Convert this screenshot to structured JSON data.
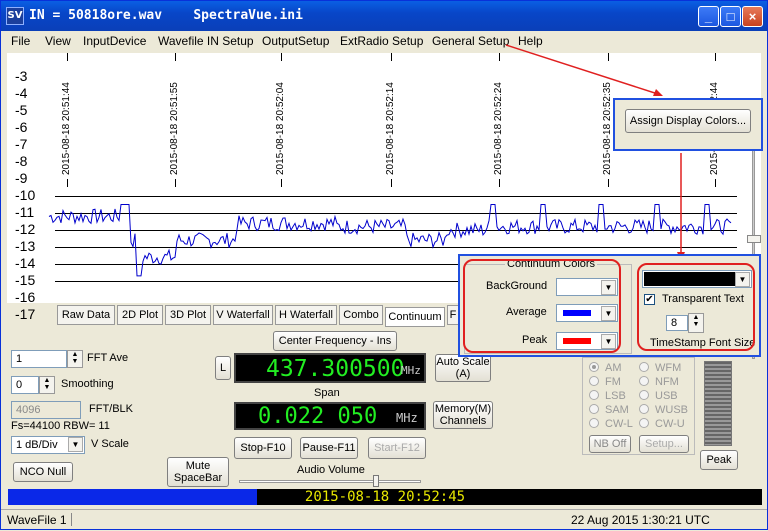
{
  "window": {
    "title": "IN = 50818ore.wav    SpectraVue.ini",
    "icon_label": "SV",
    "minimize": "_",
    "maximize": "□",
    "close": "×"
  },
  "menu": [
    "File",
    "View",
    "InputDevice",
    "Wavefile IN Setup",
    "OutputSetup",
    "ExtRadio Setup",
    "General Setup",
    "Help"
  ],
  "plot": {
    "y_ticks": [
      "-3",
      "-4",
      "-5",
      "-6",
      "-7",
      "-8",
      "-9",
      "-10",
      "-11",
      "-12",
      "-13",
      "-14",
      "-15",
      "-16",
      "-17"
    ],
    "time_labels": [
      "2015-08-18 20:51:44",
      "2015-08-18 20:51:55",
      "2015-08-18 20:52:04",
      "2015-08-18 20:52:14",
      "2015-08-18 20:52:24",
      "2015-08-18 20:52:35",
      "2015-08-18 20:52:44"
    ],
    "line_color": "#0000CC"
  },
  "tabs": [
    "Raw Data",
    "2D Plot",
    "3D Plot",
    "V Waterfall",
    "H Waterfall",
    "Combo",
    "Continuum",
    "F"
  ],
  "controls": {
    "fft_ave_value": "1",
    "fft_ave_label": "FFT Ave",
    "smoothing_value": "0",
    "smoothing_label": "Smoothing",
    "fft_blk_value": "4096",
    "fft_blk_label": "FFT/BLK",
    "fs_rbw": "Fs=44100 RBW=  11",
    "vscale_value": "1 dB/Div",
    "vscale_label": "V Scale",
    "nco_null": "NCO Null",
    "mute": "Mute\nSpaceBar",
    "center_freq_btn": "Center Frequency - Ins",
    "l_btn": "L",
    "frequency": "437.300500",
    "freq_unit": "MHz",
    "span_label": "Span",
    "span": "0.022 050",
    "span_unit": "MHz",
    "auto_scale": "Auto Scale\n(A)",
    "memory": "Memory(M)\nChannels",
    "stop": "Stop-F10",
    "pause": "Pause-F11",
    "start": "Start-F12",
    "audio_volume": "Audio Volume",
    "peak": "Peak",
    "nb_off": "NB Off",
    "setup": "Setup...",
    "modes_left": [
      "AM",
      "FM",
      "LSB",
      "SAM",
      "CW-L"
    ],
    "modes_right": [
      "WFM",
      "NFM",
      "USB",
      "WUSB",
      "CW-U"
    ]
  },
  "timestamp_bar": {
    "text": "2015-08-18 20:52:45",
    "progress": 0.33,
    "fill_color": "#0A28E8"
  },
  "status": {
    "left": "WaveFile 1",
    "right": "22 Aug 2015  1:30:21 UTC"
  },
  "callout": {
    "button": "Assign Display Colors..."
  },
  "continuum_panel": {
    "group_title": "Continuum Colors",
    "background_label": "BackGround",
    "average_label": "Average",
    "peak_label": "Peak",
    "background_color": "#FFFFFF",
    "average_color": "#0000FF",
    "peak_color": "#FF0000",
    "transparent_text_label": "Transparent Text",
    "transparent_checked": true,
    "font_size_value": "8",
    "font_size_label": "TimeStamp Font Size",
    "timestamp_color": "#000000"
  }
}
